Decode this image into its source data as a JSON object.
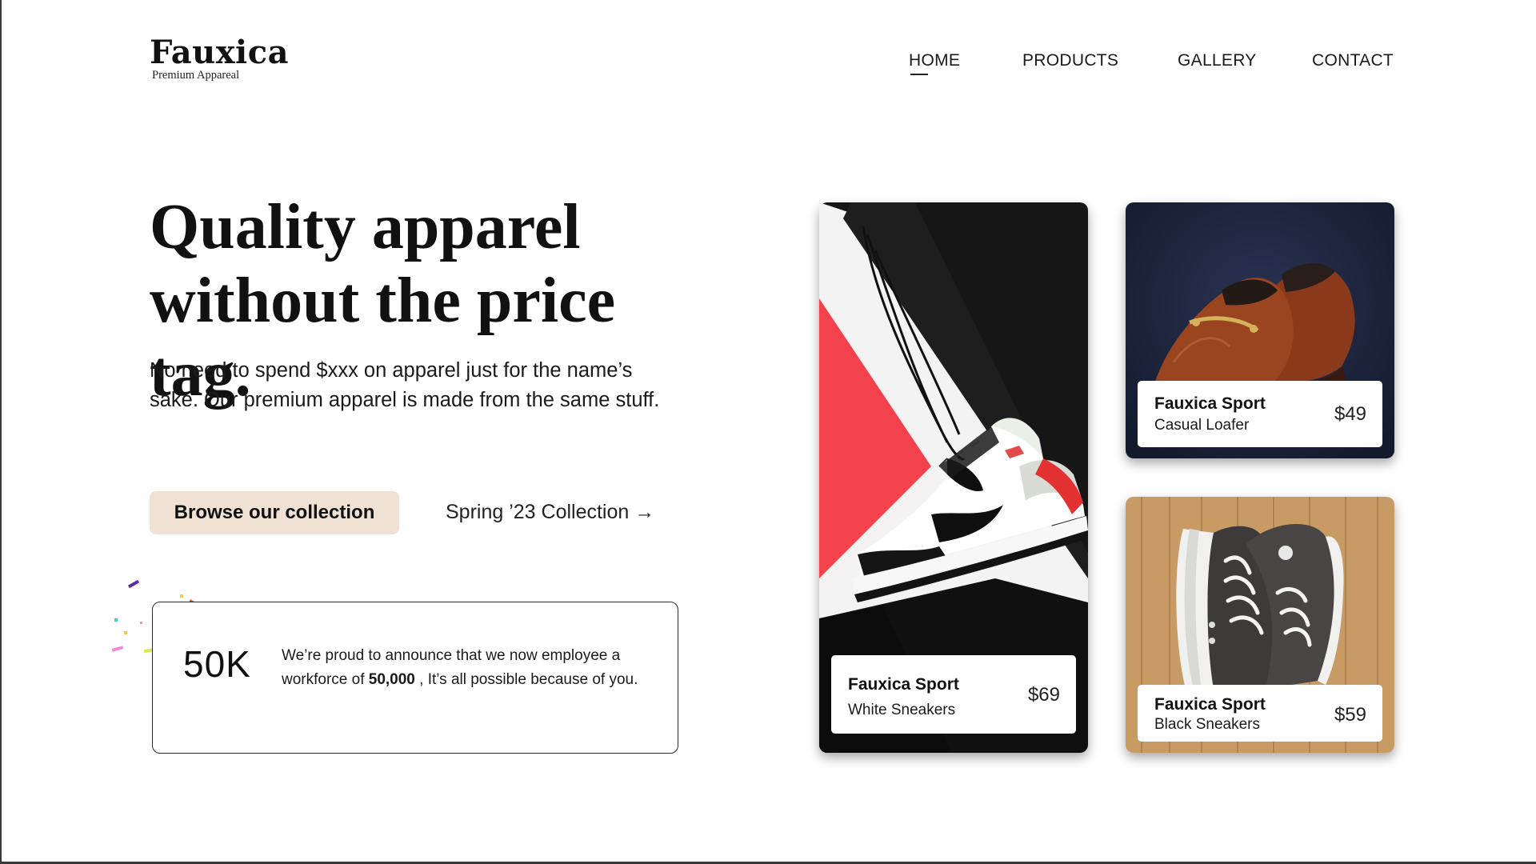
{
  "brand": {
    "name": "Fauxica",
    "tagline": "Premium Appareal"
  },
  "nav": {
    "items": [
      {
        "label": "HOME",
        "active": true
      },
      {
        "label": "PRODUCTS",
        "active": false
      },
      {
        "label": "GALLERY",
        "active": false
      },
      {
        "label": "CONTACT",
        "active": false
      }
    ]
  },
  "hero": {
    "title_line1": "Quality apparel",
    "title_line2": "without the price tag.",
    "description": "No need to spend $xxx on apparel just for the name’s sake. Our premium apparel is made from the same stuff.",
    "cta_label": "Browse our collection",
    "secondary_link": "Spring ’23 Collection →"
  },
  "stat": {
    "value": "50K",
    "text_before": "We’re proud to announce that we now employee a workforce of ",
    "text_bold": "50,000",
    "text_after": " , It’s all possible because of you."
  },
  "products": [
    {
      "brand": "Fauxica Sport",
      "name": "White Sneakers",
      "price": "$69"
    },
    {
      "brand": "Fauxica Sport",
      "name": "Casual Loafer",
      "price": "$49"
    },
    {
      "brand": "Fauxica Sport",
      "name": "Black Sneakers",
      "price": "$59"
    }
  ],
  "colors": {
    "cta_bg": "#efe2d4",
    "text": "#111111",
    "accent_red": "#f0444e"
  }
}
